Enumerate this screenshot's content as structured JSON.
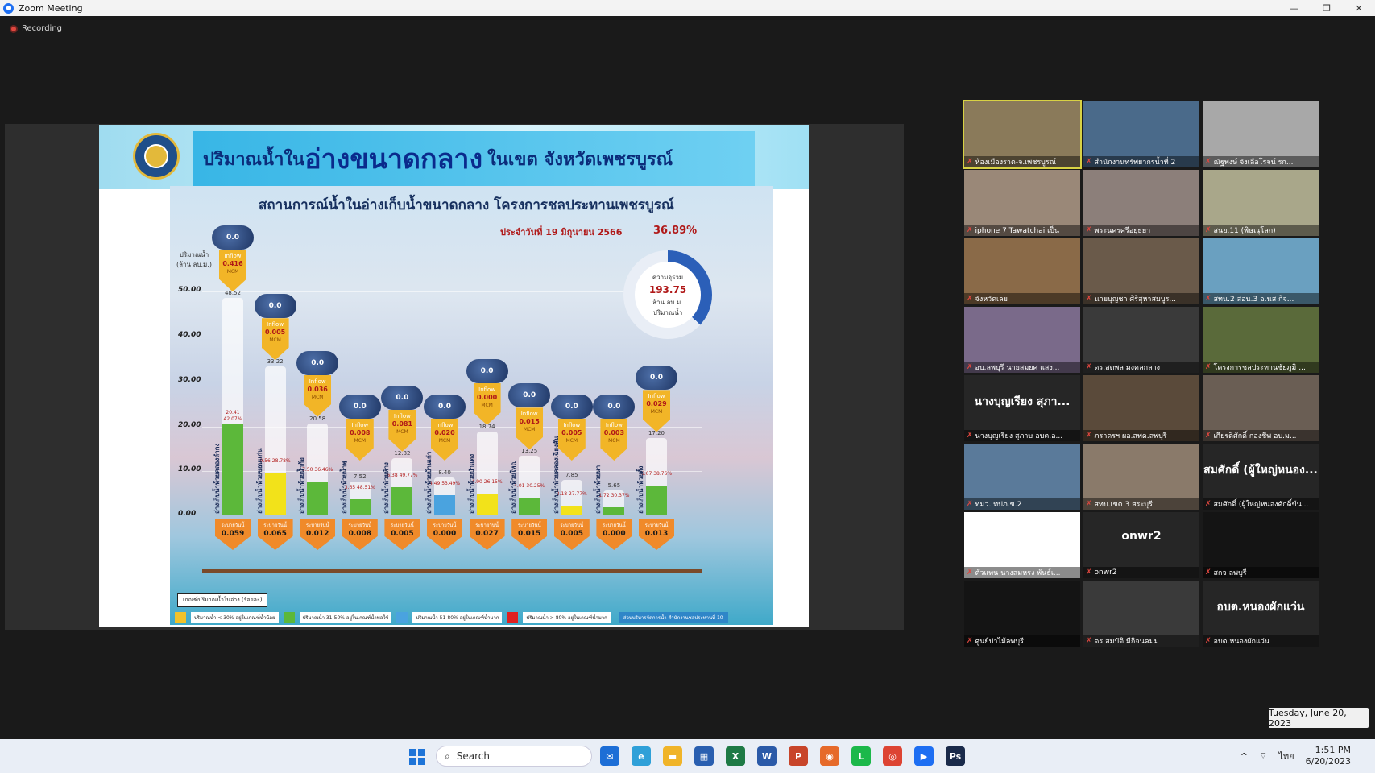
{
  "window": {
    "title": "Zoom Meeting",
    "controls": [
      "—",
      "❐",
      "✕"
    ]
  },
  "recording": {
    "label": "Recording"
  },
  "slide": {
    "title_prefix": "ปริมาณน้ำใน",
    "title_emph": "อ่างขนาดกลาง",
    "title_suffix": "ในเขต จังหวัดเพชรบูรณ์",
    "seal_label": "กรมชลประทาน",
    "subtitle": "สถานการณ์น้ำในอ่างเก็บน้ำขนาดกลาง โครงการชลประทานเพชรบูรณ์",
    "date": "ประจำวันที่ 19 มิถุนายน 2566",
    "percent": "36.89%",
    "donut": {
      "label_top": "ความจุรวม",
      "value": "193.75",
      "unit": "ล้าน ลบ.ม.",
      "ring_label": "ปริมาณน้ำ"
    },
    "ylabel_1": "ปริมาณน้ำ",
    "ylabel_2": "(ล้าน ลบ.ม.)",
    "yticks": [
      "50.00",
      "40.00",
      "30.00",
      "20.00",
      "10.00",
      "0.00"
    ],
    "criteria_label": "เกณฑ์ปริมาณน้ำในอ่าง (ร้อยละ)",
    "legend": [
      {
        "color": "#f2c22a",
        "text": "ปริมาณน้ำ < 30% อยู่ในเกณฑ์น้ำน้อย"
      },
      {
        "color": "#5cb83a",
        "text": "ปริมาณน้ำ 31-50% อยู่ในเกณฑ์น้ำพอใช้"
      },
      {
        "color": "#4aa3df",
        "text": "ปริมาณน้ำ 51-80% อยู่ในเกณฑ์น้ำมาก"
      },
      {
        "color": "#e02020",
        "text": "ปริมาณน้ำ > 80% อยู่ในเกณฑ์น้ำมาก"
      }
    ],
    "source": "ส่วนบริหารจัดการน้ำ สำนักงานชลประทานที่ 10",
    "inflow_word": "Inflow",
    "unit_word": "MCM",
    "outflow_word": "ระบายวันนี้"
  },
  "chart_data": {
    "type": "bar",
    "title": "สถานการณ์น้ำในอ่างเก็บน้ำขนาดกลาง โครงการชลประทานเพชรบูรณ์",
    "ylabel": "ปริมาณน้ำ (ล้าน ลบ.ม.)",
    "ylim": [
      0,
      55
    ],
    "reservoirs": [
      {
        "name": "อ่างเก็บน้ำห้วยคลองลำกง",
        "rain": "0.0",
        "capacity": 48.52,
        "current": 20.41,
        "percent": "42.07%",
        "inflow": "0.416",
        "outflow": "0.059",
        "fill": "#5cb83a"
      },
      {
        "name": "อ่างเก็บน้ำห้วยขอนแก่น",
        "rain": "0.0",
        "capacity": 33.22,
        "current": 9.56,
        "percent": "28.78%",
        "inflow": "0.005",
        "outflow": "0.065",
        "fill": "#f2e21a"
      },
      {
        "name": "อ่างเก็บน้ำห้วยน้ำก้อ",
        "rain": "0.0",
        "capacity": 20.58,
        "current": 7.5,
        "percent": "36.46%",
        "inflow": "0.036",
        "outflow": "0.012",
        "fill": "#5cb83a"
      },
      {
        "name": "อ่างเก็บน้ำห้วยน้ำพุ",
        "rain": "0.0",
        "capacity": 7.52,
        "current": 3.65,
        "percent": "48.51%",
        "inflow": "0.008",
        "outflow": "0.008",
        "fill": "#5cb83a"
      },
      {
        "name": "อ่างเก็บน้ำห้วยห้าง",
        "rain": "0.0",
        "capacity": 12.82,
        "current": 6.38,
        "percent": "49.77%",
        "inflow": "0.081",
        "outflow": "0.005",
        "fill": "#5cb83a"
      },
      {
        "name": "อ่างเก็บน้ำห้วยบ้านเก่า",
        "rain": "0.0",
        "capacity": 8.4,
        "current": 4.49,
        "percent": "53.49%",
        "inflow": "0.020",
        "outflow": "0.000",
        "fill": "#4aa3df"
      },
      {
        "name": "อ่างเก็บน้ำห้วยป่าแดง",
        "rain": "0.0",
        "capacity": 18.74,
        "current": 4.9,
        "percent": "26.15%",
        "inflow": "0.000",
        "outflow": "0.027",
        "fill": "#f2e21a"
      },
      {
        "name": "อ่างเก็บน้ำห้วยใหญ่",
        "rain": "0.0",
        "capacity": 13.25,
        "current": 4.01,
        "percent": "30.25%",
        "inflow": "0.015",
        "outflow": "0.015",
        "fill": "#5cb83a"
      },
      {
        "name": "อ่างเก็บน้ำห้วยคลองเฉียงสัน",
        "rain": "0.0",
        "capacity": 7.85,
        "current": 2.18,
        "percent": "27.77%",
        "inflow": "0.005",
        "outflow": "0.005",
        "fill": "#f2e21a"
      },
      {
        "name": "อ่างเก็บน้ำห้วยนา",
        "rain": "0.0",
        "capacity": 5.65,
        "current": 1.72,
        "percent": "30.37%",
        "inflow": "0.003",
        "outflow": "0.000",
        "fill": "#5cb83a"
      },
      {
        "name": "อ่างเก็บน้ำห้วยตั้ง",
        "rain": "0.0",
        "capacity": 17.2,
        "current": 6.67,
        "percent": "38.76%",
        "inflow": "0.029",
        "outflow": "0.013",
        "fill": "#5cb83a"
      }
    ]
  },
  "participants": [
    {
      "name": "ห้องเมืองราด-จ.เพชรบูรณ์",
      "bg": "#8a7a5a",
      "active": true
    },
    {
      "name": "สำนักงานทรัพยากรน้ำที่ 2",
      "bg": "#4a6a8a",
      "active": false
    },
    {
      "name": "ณัฐพงษ์ จังเลือโรจน์ รก...",
      "bg": "#a8a8a8",
      "active": false
    },
    {
      "name": "iphone 7 Tawatchai เป็น",
      "bg": "#9a8878",
      "active": false
    },
    {
      "name": "พระนครศรีอยุธยา",
      "bg": "#8c7f7a",
      "active": false
    },
    {
      "name": "สนย.11 (พิษณุโลก)",
      "bg": "#a9a78a",
      "active": false
    },
    {
      "name": "จังหวัดเลย",
      "bg": "#8a6a48",
      "active": false
    },
    {
      "name": "นายบุญชา ศิริสุหาสมบูร...",
      "bg": "#6a5a4a",
      "active": false
    },
    {
      "name": "สทน.2 สอน.3 อเนส กิจ...",
      "bg": "#6aa0c0",
      "active": false
    },
    {
      "name": "อบ.ลพบุรี นายสมยศ แสง...",
      "bg": "#7a6a8a",
      "active": false
    },
    {
      "name": "ดร.สตพล มงคลกลาง",
      "bg": "#3a3a3a",
      "active": false
    },
    {
      "name": "โครงการชลประทานชัยภูมิ ...",
      "bg": "#5a6a3a",
      "active": false
    },
    {
      "name": "นางบุญเรียง สุภาษ อบต.อ...",
      "bg": "#262626",
      "big": "นางบุญเรียง สุภา...",
      "active": false
    },
    {
      "name": "ภราดรฯ ผอ.สพด.ลพบุรี",
      "bg": "#5a4a3a",
      "active": false
    },
    {
      "name": "เกียรติศักดิ์ กองชีพ อบ.ม...",
      "bg": "#6a5e54",
      "active": false
    },
    {
      "name": "ทมว. ทปภ.ข.2",
      "bg": "#5a7a9a",
      "active": false
    },
    {
      "name": "สทบ.เขต 3 สระบุรี",
      "bg": "#8a7a6a",
      "active": false
    },
    {
      "name": "สมศักดิ์ (ผู้ใหญ่หนองศักดิ์ข้น...",
      "bg": "#262626",
      "big": "สมศักดิ์ (ผู้ใหญ่หนอง...",
      "active": false
    },
    {
      "name": "ตัวแทน นางสมหรง พันธ์เ...",
      "bg": "#ffffff",
      "active": false
    },
    {
      "name": "onwr2",
      "bg": "#262626",
      "big": "onwr2",
      "active": false
    },
    {
      "name": "สกจ ลพบุรี",
      "bg": "#141414",
      "active": false
    },
    {
      "name": "ศูนย์ปาไม้ลพบุรี",
      "bg": "#141414",
      "active": false
    },
    {
      "name": "ดร.สมบัติ มีกิจนคมม",
      "bg": "#3a3a3a",
      "active": false
    },
    {
      "name": "อบต.หนองผักแว่น",
      "bg": "#262626",
      "big": "อบต.หนองผักแว่น",
      "active": false
    }
  ],
  "date_badge": "Tuesday, June 20, 2023",
  "taskbar": {
    "search_label": "Search",
    "apps": [
      {
        "name": "mail",
        "color": "#1d6ed6",
        "glyph": "✉"
      },
      {
        "name": "edge",
        "color": "#2fa0d8",
        "glyph": "e"
      },
      {
        "name": "explorer",
        "color": "#f0b429",
        "glyph": "▬"
      },
      {
        "name": "store",
        "color": "#2a5fb0",
        "glyph": "▦"
      },
      {
        "name": "excel",
        "color": "#1e7a45",
        "glyph": "X"
      },
      {
        "name": "word",
        "color": "#2b5aa8",
        "glyph": "W"
      },
      {
        "name": "powerpoint",
        "color": "#c8452a",
        "glyph": "P"
      },
      {
        "name": "firefox",
        "color": "#e66a2a",
        "glyph": "◉"
      },
      {
        "name": "line",
        "color": "#1cb84a",
        "glyph": "L"
      },
      {
        "name": "chrome",
        "color": "#dd4433",
        "glyph": "◎"
      },
      {
        "name": "zoom",
        "color": "#1d6ef2",
        "glyph": "▶"
      },
      {
        "name": "photoshop",
        "color": "#1a2a4a",
        "glyph": "Ps"
      }
    ],
    "tray": {
      "chevron": "^",
      "lang": "ไทย",
      "time": "1:51 PM",
      "date": "6/20/2023"
    }
  }
}
